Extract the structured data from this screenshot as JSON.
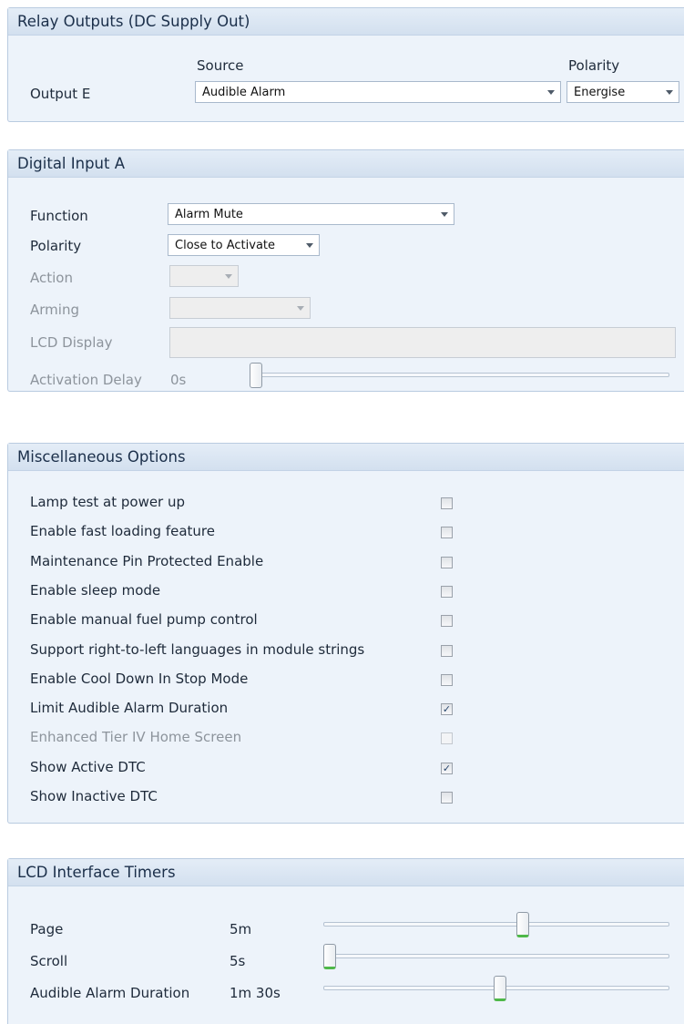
{
  "relay_outputs": {
    "title": "Relay Outputs (DC Supply Out)",
    "source_header": "Source",
    "polarity_header": "Polarity",
    "output_label": "Output E",
    "source_value": "Audible Alarm",
    "polarity_value": "Energise"
  },
  "digital_input": {
    "title": "Digital Input A",
    "function_label": "Function",
    "function_value": "Alarm Mute",
    "polarity_label": "Polarity",
    "polarity_value": "Close to Activate",
    "action_label": "Action",
    "action_value": "",
    "arming_label": "Arming",
    "arming_value": "",
    "lcd_display_label": "LCD Display",
    "lcd_display_value": "",
    "activation_delay_label": "Activation Delay",
    "activation_delay_value": "0s",
    "activation_delay_slider_fraction": 0.0
  },
  "misc_options": {
    "title": "Miscellaneous Options",
    "items": [
      {
        "label": "Lamp test at power up",
        "checked": false,
        "enabled": true
      },
      {
        "label": "Enable fast loading feature",
        "checked": false,
        "enabled": true
      },
      {
        "label": "Maintenance Pin Protected Enable",
        "checked": false,
        "enabled": true
      },
      {
        "label": "Enable sleep mode",
        "checked": false,
        "enabled": true
      },
      {
        "label": "Enable manual fuel pump control",
        "checked": false,
        "enabled": true
      },
      {
        "label": "Support right-to-left languages in module strings",
        "checked": false,
        "enabled": true
      },
      {
        "label": "Enable Cool Down In Stop Mode",
        "checked": false,
        "enabled": true
      },
      {
        "label": "Limit Audible Alarm Duration",
        "checked": true,
        "enabled": true
      },
      {
        "label": "Enhanced Tier IV Home Screen",
        "checked": false,
        "enabled": false
      },
      {
        "label": "Show Active DTC",
        "checked": true,
        "enabled": true
      },
      {
        "label": "Show Inactive DTC",
        "checked": false,
        "enabled": true
      }
    ]
  },
  "lcd_timers": {
    "title": "LCD Interface Timers",
    "items": [
      {
        "label": "Page",
        "value": "5m",
        "slider_fraction": 0.58
      },
      {
        "label": "Scroll",
        "value": "5s",
        "slider_fraction": 0.0
      },
      {
        "label": "Audible Alarm Duration",
        "value": "1m 30s",
        "slider_fraction": 0.51
      }
    ]
  }
}
